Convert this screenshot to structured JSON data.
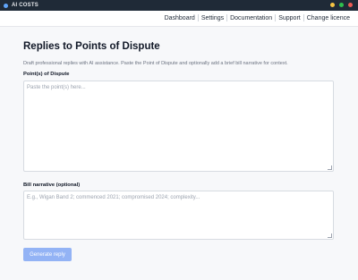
{
  "window": {
    "title": "AI COSTS",
    "accent": "#1f2a37"
  },
  "nav": {
    "items": [
      {
        "label": "Dashboard"
      },
      {
        "label": "Settings"
      },
      {
        "label": "Documentation"
      },
      {
        "label": "Support"
      },
      {
        "label": "Change licence"
      }
    ]
  },
  "page": {
    "title": "Replies to Points of Dispute",
    "subtitle": "Draft professional replies with AI assistance. Paste the Point of Dispute and optionally add a brief bill narrative for context."
  },
  "form": {
    "dispute_label": "Point(s) of Dispute",
    "dispute_placeholder": "Paste the point(s) here...",
    "narrative_label": "Bill narrative (optional)",
    "narrative_placeholder": "E.g., Wigan Band 2; commenced 2021; compromised 2024; complexity...",
    "generate_label": "Generate reply",
    "button_color": "#93b3f5"
  }
}
